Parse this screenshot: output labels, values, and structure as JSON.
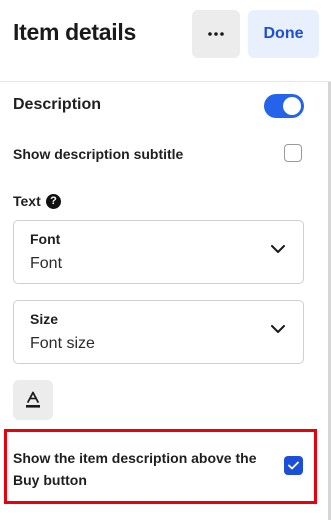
{
  "header": {
    "title": "Item details",
    "more_icon": "ellipsis-icon",
    "done_label": "Done"
  },
  "description": {
    "label": "Description",
    "toggle_on": true
  },
  "description_subtitle": {
    "label": "Show description subtitle",
    "checked": false
  },
  "text_section": {
    "label": "Text",
    "help_icon": "question-circle-icon",
    "help_glyph": "?"
  },
  "font_select": {
    "label": "Font",
    "value": "Font"
  },
  "size_select": {
    "label": "Size",
    "value": "Font size"
  },
  "text_color_button": {
    "icon": "text-color-icon"
  },
  "show_above_buy": {
    "label": "Show the item description above the Buy button",
    "checked": true
  },
  "colors": {
    "accent": "#2563eb",
    "done_text": "#1d4ed8",
    "done_bg": "#e8effd",
    "highlight": "#e8000b"
  }
}
